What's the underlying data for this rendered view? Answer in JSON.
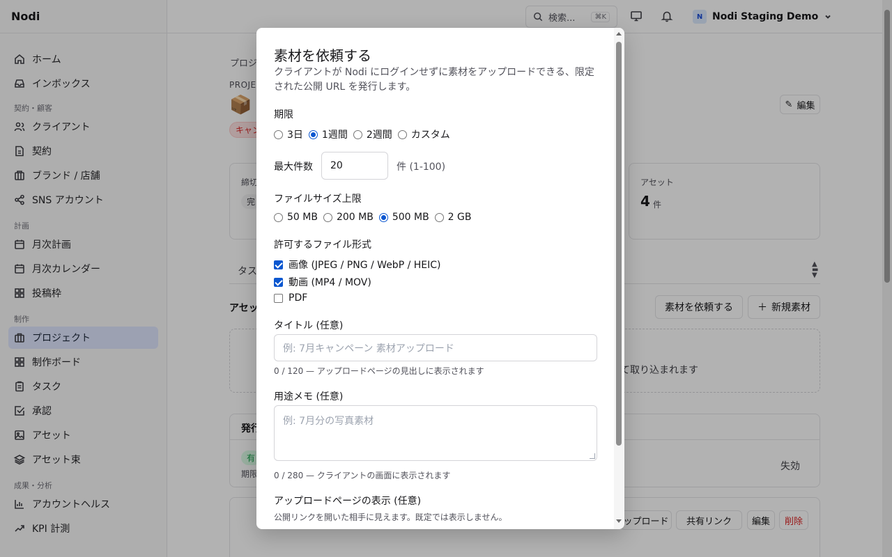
{
  "app": {
    "name": "Nodi"
  },
  "sidebar": {
    "items": [
      {
        "label": "ホーム",
        "icon": "home-icon"
      },
      {
        "label": "インボックス",
        "icon": "inbox-icon"
      }
    ],
    "groups": [
      {
        "label": "契約・顧客",
        "items": [
          {
            "label": "クライアント",
            "icon": "users-icon"
          },
          {
            "label": "契約",
            "icon": "file-icon"
          },
          {
            "label": "ブランド / 店舗",
            "icon": "store-icon"
          },
          {
            "label": "SNS アカウント",
            "icon": "share-icon"
          }
        ]
      },
      {
        "label": "計画",
        "items": [
          {
            "label": "月次計画",
            "icon": "calendar-icon"
          },
          {
            "label": "月次カレンダー",
            "icon": "calendar-icon"
          },
          {
            "label": "投稿枠",
            "icon": "grid-icon"
          }
        ]
      },
      {
        "label": "制作",
        "items": [
          {
            "label": "プロジェクト",
            "icon": "briefcase-icon",
            "active": true
          },
          {
            "label": "制作ボード",
            "icon": "grid-icon"
          },
          {
            "label": "タスク",
            "icon": "clipboard-icon"
          },
          {
            "label": "承認",
            "icon": "check-square-icon"
          },
          {
            "label": "アセット",
            "icon": "image-icon"
          },
          {
            "label": "アセット束",
            "icon": "layers-icon"
          }
        ]
      },
      {
        "label": "成果・分析",
        "items": [
          {
            "label": "アカウントヘルス",
            "icon": "bar-chart-icon"
          },
          {
            "label": "KPI 計測",
            "icon": "trend-icon"
          }
        ]
      }
    ]
  },
  "topbar": {
    "search_label": "検索...",
    "search_shortcut": "⌘K",
    "workspace_badge": "N",
    "workspace_name": "Nodi Staging Demo"
  },
  "background": {
    "breadcrumb": "プロジ",
    "project_label": "PROJEC",
    "edit_button": "編集",
    "status_pill": "キャン",
    "stat_deadline_label": "締切",
    "stat_done_pill": "完",
    "stat_assets_label": "アセット",
    "stat_assets_value": "4",
    "stat_assets_unit": "件",
    "tasks_tab": "タス",
    "assets_heading": "アセッ",
    "request_button": "素材を依頼する",
    "new_asset_button": "新規素材",
    "drop_text": "て取り込まれます",
    "issued_heading": "発行",
    "valid_pill": "有",
    "period_label": "期限",
    "expire_text": "失効",
    "row_upload": "ップロード",
    "row_share": "共有リンク",
    "row_edit": "編集",
    "row_delete": "削除"
  },
  "modal": {
    "title": "素材を依頼する",
    "description": "クライアントが Nodi にログインせずに素材をアップロードできる、限定された公開 URL を発行します。",
    "period": {
      "label": "期限",
      "options": [
        {
          "label": "3日",
          "selected": false
        },
        {
          "label": "1週間",
          "selected": true
        },
        {
          "label": "2週間",
          "selected": false
        },
        {
          "label": "カスタム",
          "selected": false
        }
      ]
    },
    "max_count": {
      "label": "最大件数",
      "value": "20",
      "unit": "件 (1-100)"
    },
    "file_size": {
      "label": "ファイルサイズ上限",
      "options": [
        {
          "label": "50 MB",
          "selected": false
        },
        {
          "label": "200 MB",
          "selected": false
        },
        {
          "label": "500 MB",
          "selected": true
        },
        {
          "label": "2 GB",
          "selected": false
        }
      ]
    },
    "formats": {
      "label": "許可するファイル形式",
      "options": [
        {
          "label": "画像 (JPEG / PNG / WebP / HEIC)",
          "checked": true
        },
        {
          "label": "動画 (MP4 / MOV)",
          "checked": true
        },
        {
          "label": "PDF",
          "checked": false
        }
      ]
    },
    "title_field": {
      "label": "タイトル (任意)",
      "placeholder": "例: 7月キャンペーン 素材アップロード",
      "hint": "0 / 120 — アップロードページの見出しに表示されます"
    },
    "memo_field": {
      "label": "用途メモ (任意)",
      "placeholder": "例: 7月分の写真素材",
      "hint": "0 / 280 — クライアントの画面に表示されます"
    },
    "display": {
      "label": "アップロードページの表示 (任意)",
      "description": "公開リンクを開いた相手に見えます。既定では表示しません。"
    }
  }
}
